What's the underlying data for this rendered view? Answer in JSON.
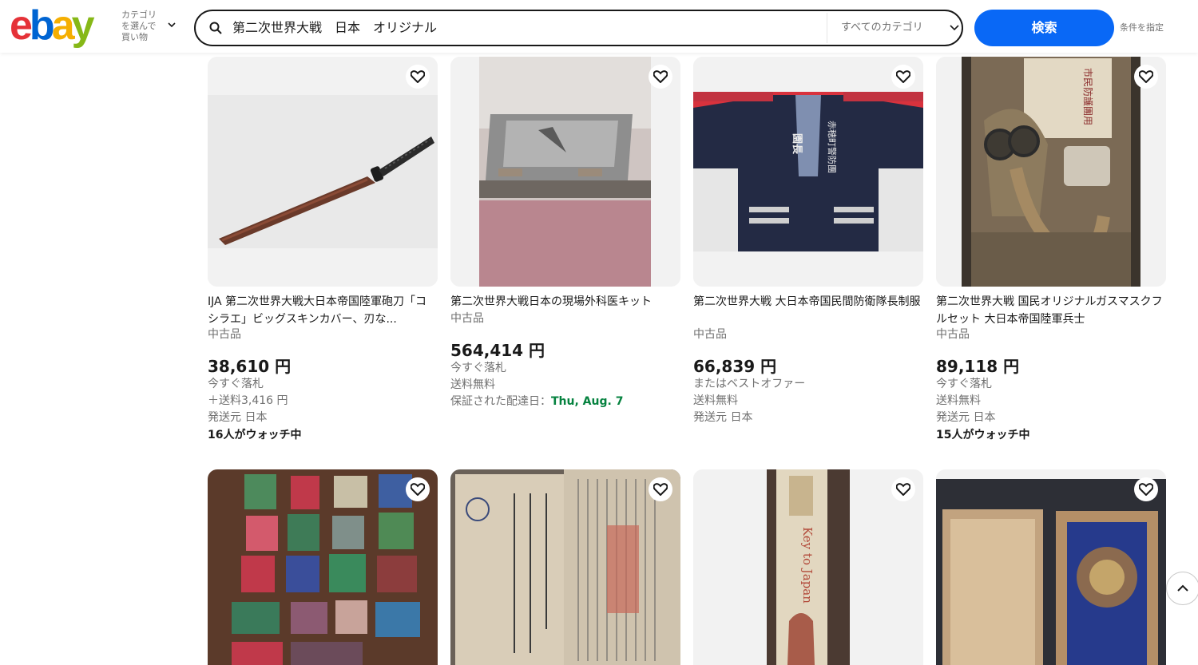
{
  "header": {
    "logo": [
      "e",
      "b",
      "a",
      "y"
    ],
    "category_shop_lines": [
      "カテゴリ",
      "を選んで",
      "買い物"
    ],
    "search_query": "第二次世界大戦　日本　オリジナル",
    "category_select": "すべてのカテゴリ",
    "search_button": "検索",
    "advanced_link": "条件を指定"
  },
  "items": [
    {
      "title": "IJA 第二次世界大戦大日本帝国陸軍砲刀「コシラエ」ビッグスキンカバー、刃な...",
      "condition": "中古品",
      "price": "38,610 円",
      "buy_format": "今すぐ落札",
      "shipping": "＋送料3,416 円",
      "location": "発送元 日本",
      "watchers": "16人がウォッチ中"
    },
    {
      "title": "第二次世界大戦日本の現場外科医キット",
      "condition": "中古品",
      "price": "564,414 円",
      "buy_format": "今すぐ落札",
      "shipping": "送料無料",
      "delivery_label": "保証された配達日：",
      "delivery_date": "Thu, Aug. 7"
    },
    {
      "title": "第二次世界大戦 大日本帝国民間防衛隊長制服",
      "condition": "中古品",
      "price": "66,839 円",
      "buy_format": "またはベストオファー",
      "shipping": "送料無料",
      "location": "発送元 日本"
    },
    {
      "title": "第二次世界大戦 国民オリジナルガスマスクフルセット 大日本帝国陸軍兵士",
      "condition": "中古品",
      "price": "89,118 円",
      "buy_format": "今すぐ落札",
      "shipping": "送料無料",
      "location": "発送元 日本",
      "watchers": "15人がウォッチ中"
    }
  ],
  "image_texts": {
    "coat_left": "園長",
    "coat_right": "赤穂町警防團",
    "gasmask_box": "市民防護團用",
    "book_spine": "Key to Japan"
  },
  "colors": {
    "accent": "#0968f6",
    "price": "#191919",
    "secondary": "#707070",
    "delivery_green": "#05823f"
  }
}
